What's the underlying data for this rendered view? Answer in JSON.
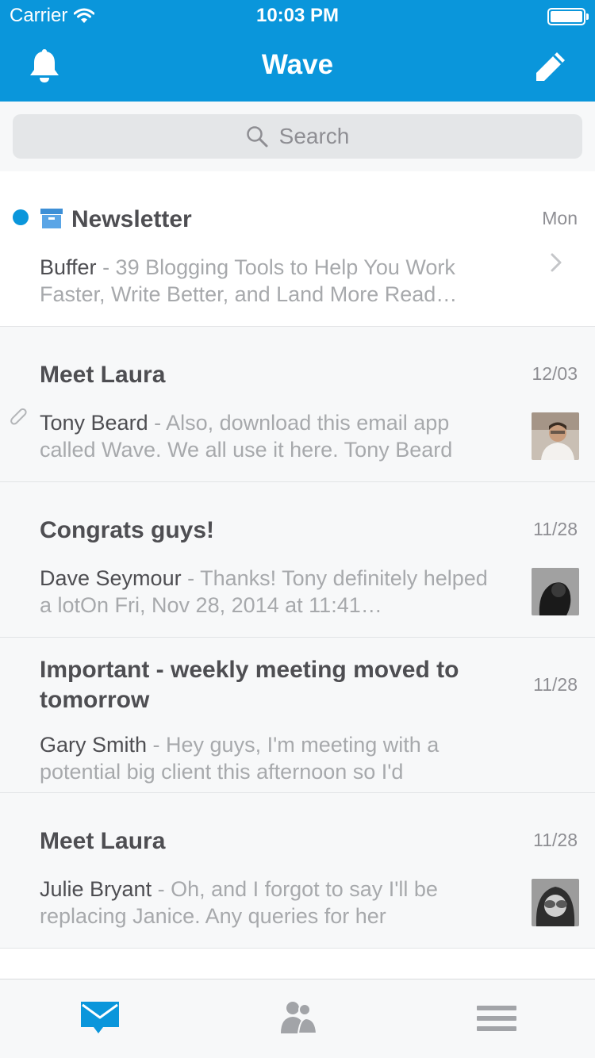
{
  "status_bar": {
    "carrier": "Carrier",
    "time": "10:03 PM"
  },
  "nav": {
    "title": "Wave"
  },
  "search": {
    "placeholder": "Search"
  },
  "messages": [
    {
      "subject": "Newsletter",
      "date": "Mon",
      "sender": "Buffer",
      "snippet": " - 39 Blogging Tools to Help You Work Faster, Write Better, and Land More Read…",
      "unread": true,
      "folder_icon": "archive-box-icon"
    },
    {
      "subject": "Meet Laura",
      "date": "12/03",
      "sender": "Tony Beard",
      "snippet": " - Also, download this email app called Wave. We all use it here. Tony Beard",
      "attachment": true
    },
    {
      "subject": "Congrats guys!",
      "date": "11/28",
      "sender": "Dave Seymour",
      "snippet": " - Thanks! Tony definitely helped a lotOn Fri, Nov 28, 2014 at 11:41…"
    },
    {
      "subject": "Important - weekly meeting moved to tomorrow",
      "date": "11/28",
      "sender": "Gary Smith",
      "snippet": " - Hey guys, I'm meeting with a potential big client this afternoon so I'd"
    },
    {
      "subject": "Meet Laura",
      "date": "11/28",
      "sender": "Julie Bryant",
      "snippet": " - Oh, and I forgot to say I'll be replacing Janice. Any queries for her"
    }
  ],
  "tabs": [
    {
      "icon": "mail-icon",
      "active": true
    },
    {
      "icon": "contacts-icon",
      "active": false
    },
    {
      "icon": "menu-icon",
      "active": false
    }
  ],
  "colors": {
    "accent": "#0a96db",
    "text": "#4e4e52",
    "muted": "#a7a9ac",
    "inactive_icon": "#a2a4a8"
  }
}
